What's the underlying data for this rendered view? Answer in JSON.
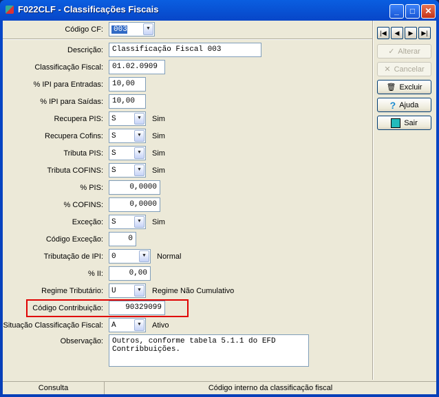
{
  "window": {
    "title": "F022CLF - Classificações Fiscais"
  },
  "header": {
    "codigo_label": "Código CF:",
    "codigo_value": "003"
  },
  "fields": [
    {
      "label": "Descrição:",
      "value": "Classificação Fiscal 003",
      "type": "text"
    },
    {
      "label": "Classificação Fiscal:",
      "value": "01.02.0909",
      "type": "text"
    },
    {
      "label": "% IPI para Entradas:",
      "value": "10,00",
      "type": "text"
    },
    {
      "label": "% IPI para Saídas:",
      "value": "10,00",
      "type": "text"
    },
    {
      "label": "Recupera PIS:",
      "value": "S",
      "type": "select",
      "desc": "Sim"
    },
    {
      "label": "Recupera Cofins:",
      "value": "S",
      "type": "select",
      "desc": "Sim"
    },
    {
      "label": "Tributa PIS:",
      "value": "S",
      "type": "select",
      "desc": "Sim"
    },
    {
      "label": "Tributa COFINS:",
      "value": "S",
      "type": "select",
      "desc": "Sim"
    },
    {
      "label": "% PIS:",
      "value": "0,0000",
      "type": "num"
    },
    {
      "label": "% COFINS:",
      "value": "0,0000",
      "type": "num"
    },
    {
      "label": "Exceção:",
      "value": "S",
      "type": "select",
      "desc": "Sim"
    },
    {
      "label": "Código Exceção:",
      "value": "0",
      "type": "num"
    },
    {
      "label": "Tributação de IPI:",
      "value": "0",
      "type": "select",
      "desc": "Normal"
    },
    {
      "label": "% II:",
      "value": "0,00",
      "type": "num"
    },
    {
      "label": "Regime Tributário:",
      "value": "U",
      "type": "select",
      "desc": "Regime Não Cumulativo"
    },
    {
      "label": "Código Contribuição:",
      "value": "90329099",
      "type": "num"
    },
    {
      "label": "Situação Classificação Fiscal:",
      "value": "A",
      "type": "select",
      "desc": "Ativo"
    }
  ],
  "observacao": {
    "label": "Observação:",
    "value": "Outros, conforme tabela 5.1.1 do EFD\nContribbuições."
  },
  "buttons": {
    "alterar": "Alterar",
    "cancelar": "Cancelar",
    "excluir": "Excluir",
    "ajuda": "Ajuda",
    "sair": "Sair"
  },
  "status": {
    "mode": "Consulta",
    "hint": "Código interno da classificação fiscal"
  }
}
